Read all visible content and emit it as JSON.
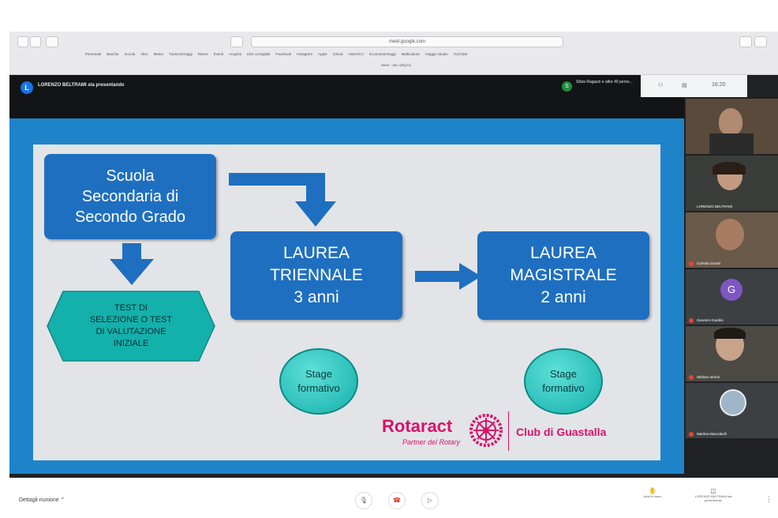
{
  "browser": {
    "url": "meet.google.com",
    "tab_title": "Meet - abc-defg-hij",
    "bookmarks": [
      "Personale",
      "Banche",
      "Scuola",
      "Altro",
      "Meteo",
      "Turismo/Viaggi",
      "Rivers",
      "Eventi",
      "Acquisti",
      "Libri consigliati",
      "Facebook",
      "Instagram",
      "Apple",
      "iCloud",
      "Unitre/CV",
      "Economia/Viaggi",
      "Multicultura",
      "Viaggio Studio",
      "YouTube"
    ]
  },
  "meet": {
    "presenter_initial": "L",
    "presenter_label": "LORENZO BELTRAMI sta presentando",
    "other_initial": "S",
    "other_label": "Silvia Ragazzi e altre 40 perso...",
    "time": "16:20"
  },
  "slide": {
    "box_school": [
      "Scuola",
      "Secondaria di",
      "Secondo Grado"
    ],
    "hex_test": [
      "TEST DI",
      "SELEZIONE O TEST",
      "DI VALUTAZIONE",
      "INIZIALE"
    ],
    "box_triennale": [
      "LAUREA",
      "TRIENNALE",
      "3 anni"
    ],
    "box_magistrale": [
      "LAUREA",
      "MAGISTRALE",
      "2 anni"
    ],
    "stage_1": [
      "Stage",
      "formativo"
    ],
    "stage_2": [
      "Stage",
      "formativo"
    ],
    "logo_name": "Rotaract",
    "logo_sub": "Partner del Rotary",
    "club": "Club di Guastalla"
  },
  "participants": [
    {
      "name": ""
    },
    {
      "name": "LORENZO BELTRAMI"
    },
    {
      "name": "Carlotta Grossi"
    },
    {
      "name": "Giovanni Gardini",
      "initial": "G"
    },
    {
      "name": "Stefano Iemmi"
    },
    {
      "name": "Martina Mancabelli"
    }
  ],
  "bottom": {
    "details": "Dettagli riunione",
    "raise_hand": "Alza la mano",
    "presenting": "LORENZO BELTRAMI sta presentando"
  },
  "colors": {
    "slide_blue": "#1f6fc0",
    "stage_teal": "#14b0ab",
    "rotaract_pink": "#d8136a"
  }
}
